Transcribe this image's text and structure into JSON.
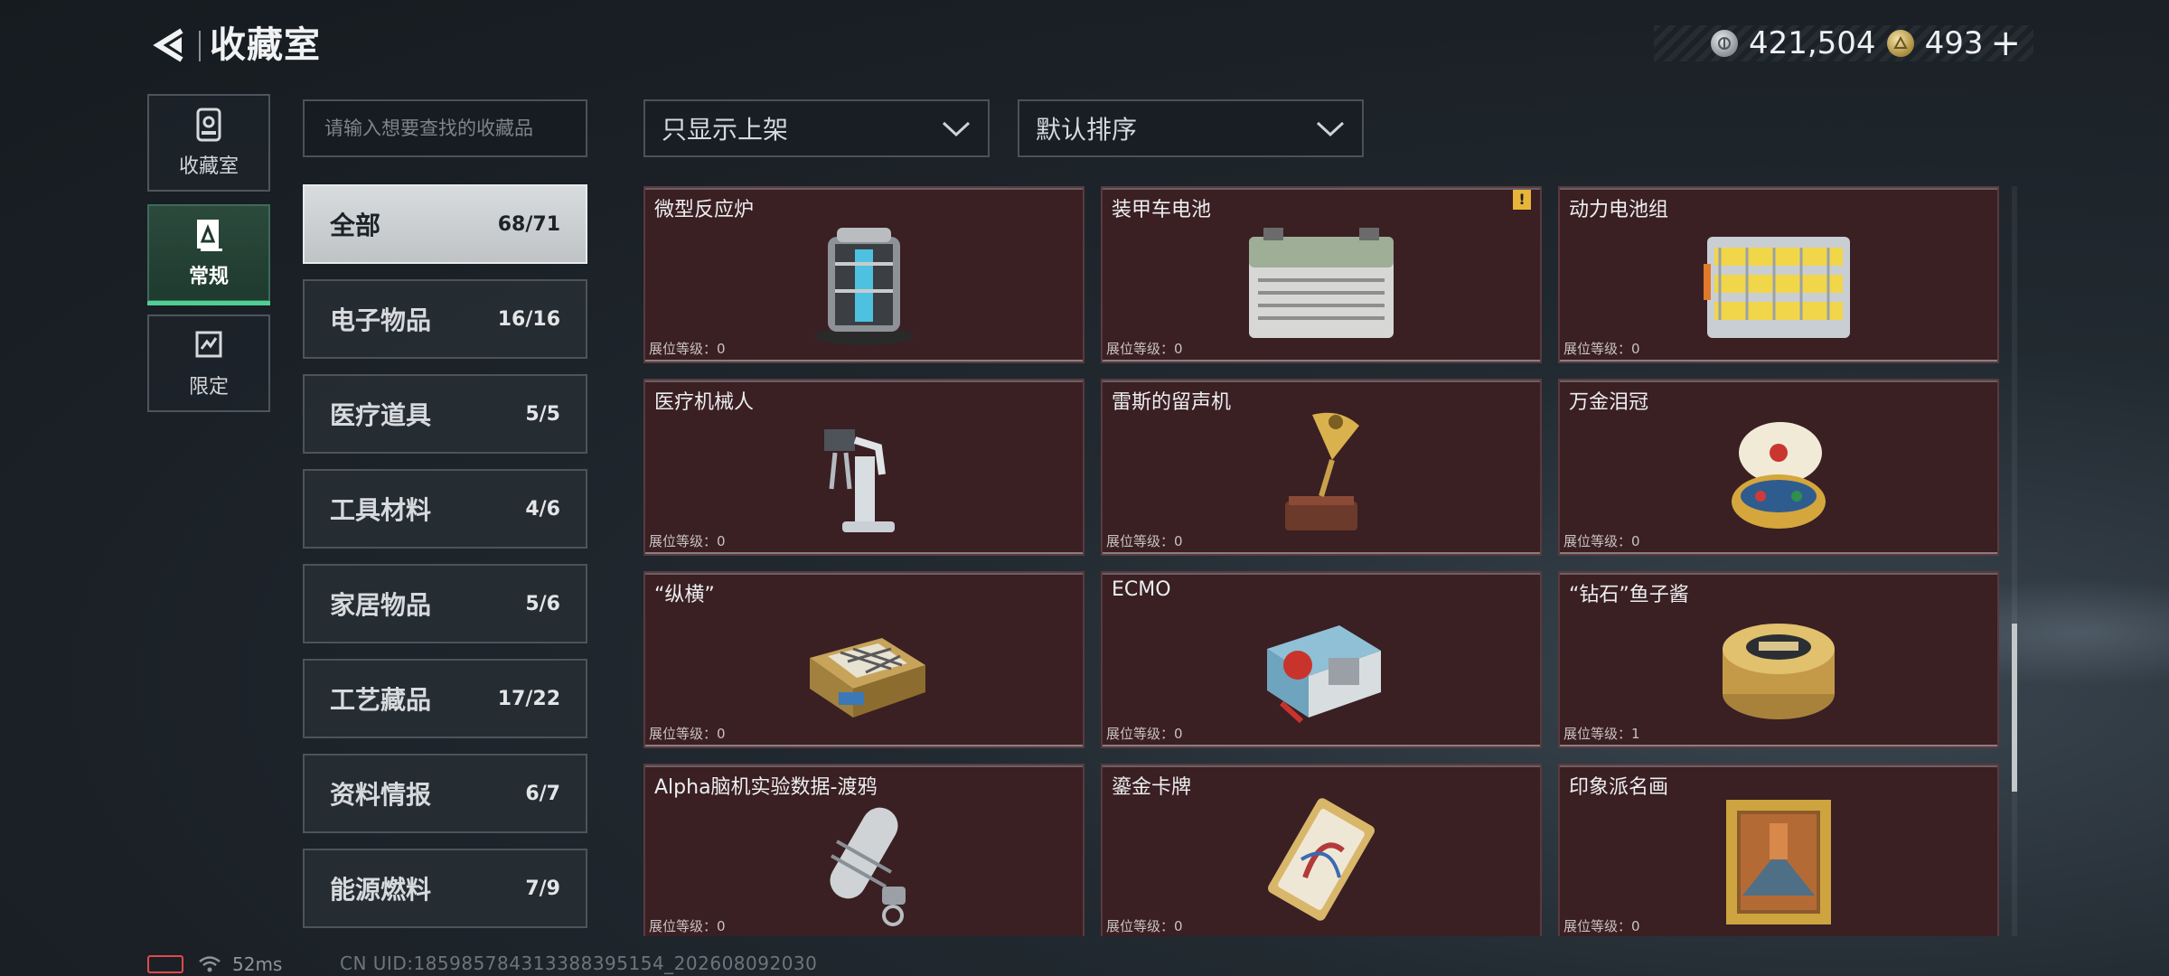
{
  "header": {
    "title": "收藏室",
    "currencies": [
      {
        "icon": "silver-coin-icon",
        "value": "421,504"
      },
      {
        "icon": "gold-coin-icon",
        "value": "493"
      }
    ],
    "add_symbol": "+"
  },
  "left_nav": {
    "items": [
      {
        "label": "收藏室",
        "icon": "collection-room-icon"
      },
      {
        "label": "常规",
        "icon": "regular-icon",
        "active": true
      },
      {
        "label": "限定",
        "icon": "limited-icon"
      }
    ]
  },
  "search": {
    "placeholder": "请输入想要查找的收藏品"
  },
  "categories": [
    {
      "name": "全部",
      "count": "68/71",
      "active": true
    },
    {
      "name": "电子物品",
      "count": "16/16"
    },
    {
      "name": "医疗道具",
      "count": "5/5"
    },
    {
      "name": "工具材料",
      "count": "4/6"
    },
    {
      "name": "家居物品",
      "count": "5/6"
    },
    {
      "name": "工艺藏品",
      "count": "17/22"
    },
    {
      "name": "资料情报",
      "count": "6/7"
    },
    {
      "name": "能源燃料",
      "count": "7/9"
    }
  ],
  "filters": {
    "display": "只显示上架",
    "sort": "默认排序"
  },
  "level_label": "展位等级：",
  "items": [
    {
      "name": "微型反应炉",
      "level": "0",
      "icon": "micro-reactor-icon"
    },
    {
      "name": "装甲车电池",
      "level": "0",
      "icon": "armored-battery-icon",
      "warning": "!"
    },
    {
      "name": "动力电池组",
      "level": "0",
      "icon": "power-battery-pack-icon"
    },
    {
      "name": "医疗机械人",
      "level": "0",
      "icon": "medical-robot-icon"
    },
    {
      "name": "雷斯的留声机",
      "level": "0",
      "icon": "gramophone-icon"
    },
    {
      "name": "万金泪冠",
      "level": "0",
      "icon": "jeweled-egg-icon"
    },
    {
      "name": "“纵横”",
      "level": "0",
      "icon": "chess-box-icon"
    },
    {
      "name": "ECMO",
      "level": "0",
      "icon": "ecmo-machine-icon"
    },
    {
      "name": "“钻石”鱼子酱",
      "level": "1",
      "icon": "caviar-tin-icon"
    },
    {
      "name": "Alpha脑机实验数据-渡鸦",
      "level": "0",
      "icon": "data-capsule-icon"
    },
    {
      "name": "鎏金卡牌",
      "level": "0",
      "icon": "gilded-card-icon"
    },
    {
      "name": "印象派名画",
      "level": "0",
      "icon": "framed-painting-icon"
    }
  ],
  "footer": {
    "ping": "52ms",
    "uid": "CN UID:1859857843133883951​54_202608092030"
  }
}
